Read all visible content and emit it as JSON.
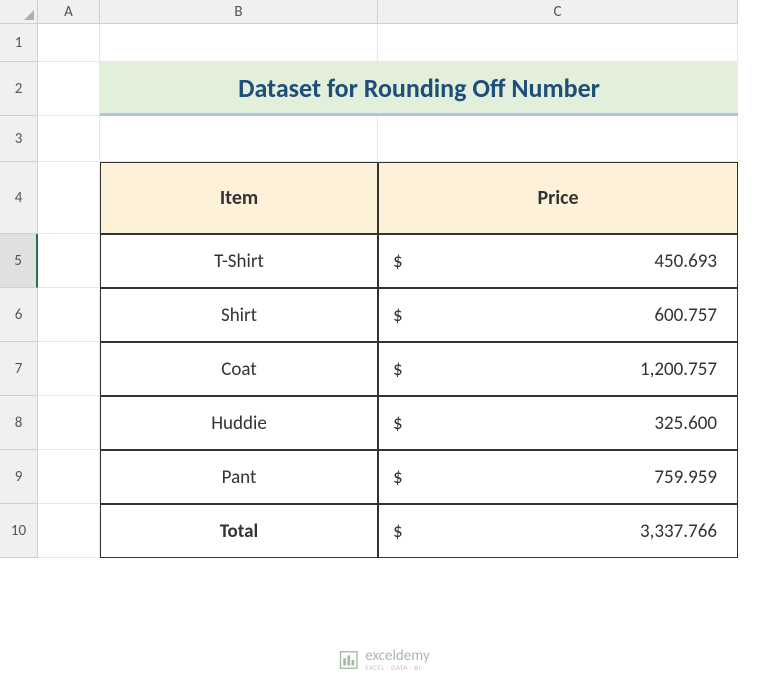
{
  "columns": [
    "A",
    "B",
    "C"
  ],
  "rows": [
    "1",
    "2",
    "3",
    "4",
    "5",
    "6",
    "7",
    "8",
    "9",
    "10"
  ],
  "title": "Dataset for Rounding Off Number",
  "headers": {
    "item": "Item",
    "price": "Price"
  },
  "data": [
    {
      "item": "T-Shirt",
      "currency": "$",
      "price": "450.693"
    },
    {
      "item": "Shirt",
      "currency": "$",
      "price": "600.757"
    },
    {
      "item": "Coat",
      "currency": "$",
      "price": "1,200.757"
    },
    {
      "item": "Huddie",
      "currency": "$",
      "price": "325.600"
    },
    {
      "item": "Pant",
      "currency": "$",
      "price": "759.959"
    }
  ],
  "total": {
    "label": "Total",
    "currency": "$",
    "value": "3,337.766"
  },
  "watermark": {
    "main": "exceldemy",
    "sub": "EXCEL · DATA · BI"
  },
  "selectedRow": 5
}
